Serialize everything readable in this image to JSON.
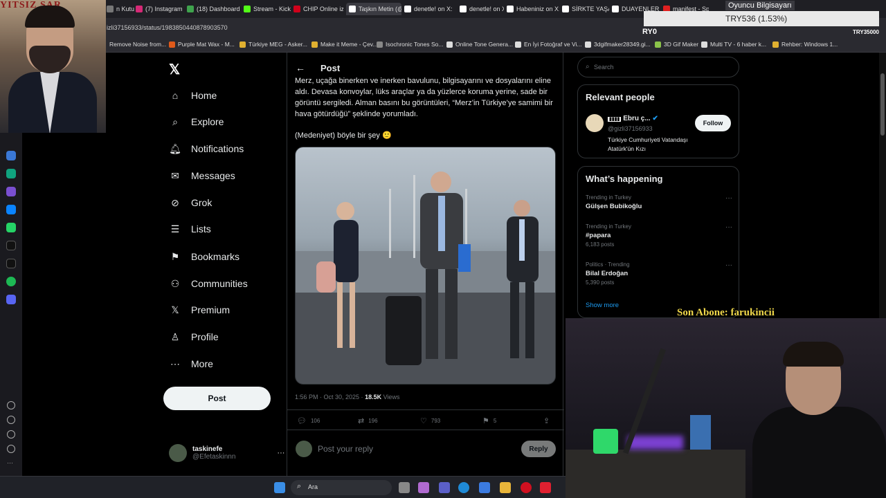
{
  "browser": {
    "tabs": [
      {
        "label": "n Kutusu (",
        "color": "#777777"
      },
      {
        "label": "(7) Instagram",
        "color": "#d62976"
      },
      {
        "label": "(18) Dashboard",
        "color": "#3fa34d"
      },
      {
        "label": "Stream - Kick D",
        "color": "#53fc18"
      },
      {
        "label": "CHIP Online iz",
        "color": "#d0021b"
      },
      {
        "label": "Taşkın Metin (@",
        "color": "#ffffff"
      },
      {
        "label": "denetle! on X:",
        "color": "#ffffff"
      },
      {
        "label": "denetle! on X:",
        "color": "#ffffff"
      },
      {
        "label": "Habeniniz on X:",
        "color": "#ffffff"
      },
      {
        "label": "SİRKTE YAŞANI",
        "color": "#ffffff"
      },
      {
        "label": "DUAYENLER Ca",
        "color": "#ffffff"
      },
      {
        "label": "manifest - Spo",
        "color": "#e02020"
      }
    ],
    "url": "izli37156933/status/1983850440878903570",
    "bookmarks": [
      {
        "label": "Remove Noise from...",
        "color": "#555555"
      },
      {
        "label": "Purple Mat Wax - M...",
        "color": "#e05a1a"
      },
      {
        "label": "Türkiye MEG - Asker...",
        "color": "#e0b030"
      },
      {
        "label": "Make it Meme - Çev...",
        "color": "#e0b030"
      },
      {
        "label": "Isochronic Tones So...",
        "color": "#888888"
      },
      {
        "label": "Online Tone Genera...",
        "color": "#dddddd"
      },
      {
        "label": "En İyi Fotoğraf ve Vi...",
        "color": "#dddddd"
      },
      {
        "label": "3dgifmaker28349.gi...",
        "color": "#dddddd"
      },
      {
        "label": "3D Gif Maker",
        "color": "#8bc34a"
      },
      {
        "label": "Multi TV - 6 haber k...",
        "color": "#dddddd"
      },
      {
        "label": "Rehber: Windows 1...",
        "color": "#e0b030"
      }
    ]
  },
  "nav": {
    "logo": "𝕏",
    "items": [
      {
        "label": "Home",
        "icon": "⌂"
      },
      {
        "label": "Explore",
        "icon": "⌕"
      },
      {
        "label": "Notifications",
        "icon": "🔔︎"
      },
      {
        "label": "Messages",
        "icon": "✉"
      },
      {
        "label": "Grok",
        "icon": "⊘"
      },
      {
        "label": "Lists",
        "icon": "☰"
      },
      {
        "label": "Bookmarks",
        "icon": "⚑"
      },
      {
        "label": "Communities",
        "icon": "⚇"
      },
      {
        "label": "Premium",
        "icon": "𝕏"
      },
      {
        "label": "Profile",
        "icon": "♙"
      },
      {
        "label": "More",
        "icon": "⋯"
      }
    ],
    "post_button": "Post",
    "account": {
      "name": "taskinefe",
      "handle": "@Efetaskinnn",
      "more": "···"
    }
  },
  "post": {
    "header": "Post",
    "back": "←",
    "text": "Merz, uçağa binerken ve inerken bavulunu, bilgisayarını ve dosyalarını eline aldı. Devasa konvoylar, lüks araçlar ya da yüzlerce koruma yerine, sade bir görüntü sergiledi. Alman basını bu görüntüleri, “Merz’in Türkiye’ye samimi bir hava götürdüğü” şeklinde yorumladı.",
    "text2": "(Medeniyet) böyle bir şey 🙂",
    "time": "1:56 PM · Oct 30, 2025 · ",
    "views": "18.5K",
    "views_label": " Views",
    "replies": "106",
    "reposts": "196",
    "likes": "793",
    "bookmarks": "5",
    "reply_placeholder": "Post your reply",
    "reply_button": "Reply"
  },
  "right": {
    "search_placeholder": "Search",
    "relevant_title": "Relevant people",
    "person": {
      "name": "Ebru ç...",
      "handle": "@gizli37156933",
      "bio": "Türkiye Cumhuriyeti Vatandaşı Atatürk'ün Kızı",
      "follow": "Follow"
    },
    "happening_title": "What’s happening",
    "trends": [
      {
        "context": "Trending in Turkey",
        "title": "Gülşen Bubikoğlu",
        "count": ""
      },
      {
        "context": "Trending in Turkey",
        "title": "#papara",
        "count": "6,183 posts"
      },
      {
        "context": "Politics · Trending",
        "title": "Bilal Erdoğan",
        "count": "5,390 posts"
      }
    ],
    "show_more": "Show more"
  },
  "overlay": {
    "ticker_label": "Oyuncu Bilgisayarı",
    "ticker": "TRY536 (1.53%)",
    "ticker_left": "RY0",
    "ticker_right": "TRY35000",
    "son_abone": "Son Abone: farukincii",
    "sign_text": "YITSIZ SAR"
  },
  "taskbar": {
    "search": "Ara"
  }
}
